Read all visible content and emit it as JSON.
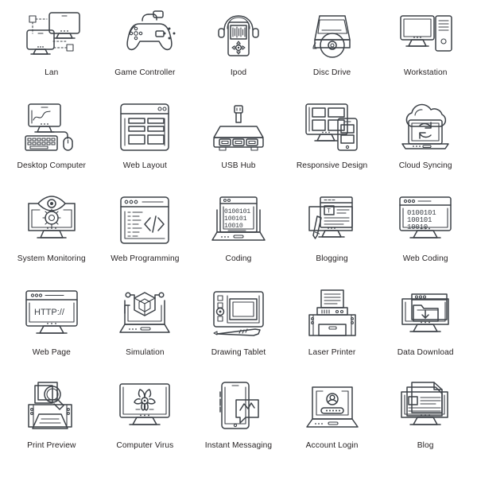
{
  "page": {
    "background_color": "#ffffff",
    "stroke_color": "#3c4147",
    "label_color": "#231f20",
    "columns": 5,
    "rows": 5
  },
  "icons": [
    {
      "id": "lan",
      "label": "Lan",
      "icon_name": "lan-icon"
    },
    {
      "id": "game-controller",
      "label": "Game Controller",
      "icon_name": "game-controller-icon"
    },
    {
      "id": "ipod",
      "label": "Ipod",
      "icon_name": "ipod-icon"
    },
    {
      "id": "disc-drive",
      "label": "Disc Drive",
      "icon_name": "disc-drive-icon"
    },
    {
      "id": "workstation",
      "label": "Workstation",
      "icon_name": "workstation-icon"
    },
    {
      "id": "desktop-computer",
      "label": "Desktop Computer",
      "icon_name": "desktop-computer-icon"
    },
    {
      "id": "web-layout",
      "label": "Web Layout",
      "icon_name": "web-layout-icon"
    },
    {
      "id": "usb-hub",
      "label": "USB Hub",
      "icon_name": "usb-hub-icon"
    },
    {
      "id": "responsive-design",
      "label": "Responsive Design",
      "icon_name": "responsive-design-icon"
    },
    {
      "id": "cloud-syncing",
      "label": "Cloud Syncing",
      "icon_name": "cloud-syncing-icon"
    },
    {
      "id": "system-monitoring",
      "label": "System Monitoring",
      "icon_name": "system-monitoring-icon"
    },
    {
      "id": "web-programming",
      "label": "Web Programming",
      "icon_name": "web-programming-icon"
    },
    {
      "id": "coding",
      "label": "Coding",
      "icon_name": "coding-icon"
    },
    {
      "id": "blogging",
      "label": "Blogging",
      "icon_name": "blogging-icon"
    },
    {
      "id": "web-coding",
      "label": "Web Coding",
      "icon_name": "web-coding-icon"
    },
    {
      "id": "web-page",
      "label": "Web Page",
      "icon_name": "web-page-icon"
    },
    {
      "id": "simulation",
      "label": "Simulation",
      "icon_name": "simulation-icon"
    },
    {
      "id": "drawing-tablet",
      "label": "Drawing Tablet",
      "icon_name": "drawing-tablet-icon"
    },
    {
      "id": "laser-printer",
      "label": "Laser Printer",
      "icon_name": "laser-printer-icon"
    },
    {
      "id": "data-download",
      "label": "Data Download",
      "icon_name": "data-download-icon"
    },
    {
      "id": "print-preview",
      "label": "Print Preview",
      "icon_name": "print-preview-icon"
    },
    {
      "id": "computer-virus",
      "label": "Computer Virus",
      "icon_name": "computer-virus-icon"
    },
    {
      "id": "instant-messaging",
      "label": "Instant Messaging",
      "icon_name": "instant-messaging-icon"
    },
    {
      "id": "account-login",
      "label": "Account Login",
      "icon_name": "account-login-icon"
    },
    {
      "id": "blog",
      "label": "Blog",
      "icon_name": "blog-icon"
    }
  ],
  "icon_text": {
    "binary_line1": "0100101",
    "binary_line2": "100101",
    "binary_line3": "10010",
    "http_text": "HTTP://",
    "code_tag": "</>",
    "blog_letter": "T"
  }
}
